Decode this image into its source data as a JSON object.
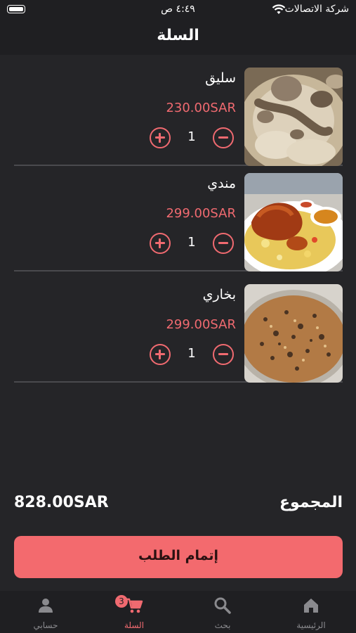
{
  "status": {
    "time": "٤:٤٩ ص",
    "carrier": "شركة الاتصالات"
  },
  "header": {
    "title": "السلة"
  },
  "cart": {
    "items": [
      {
        "name": "سليق",
        "price": "230.00SAR",
        "quantity": "1",
        "image": "saleeg-dish"
      },
      {
        "name": "مندي",
        "price": "299.00SAR",
        "quantity": "1",
        "image": "mandi-dish"
      },
      {
        "name": "بخاري",
        "price": "299.00SAR",
        "quantity": "1",
        "image": "bukhari-dish"
      }
    ]
  },
  "summary": {
    "total_label": "المجموع",
    "total_value": "828.00SAR"
  },
  "checkout": {
    "label": "إتمام الطلب"
  },
  "tabbar": {
    "items": [
      {
        "label": "الرئيسية",
        "icon": "home-icon"
      },
      {
        "label": "بحث",
        "icon": "search-icon"
      },
      {
        "label": "السلة",
        "icon": "cart-icon",
        "badge": "3",
        "active": true
      },
      {
        "label": "حسابي",
        "icon": "person-icon"
      }
    ]
  },
  "colors": {
    "accent": "#f06a70",
    "background": "#252528",
    "bar": "#1f1f22"
  }
}
